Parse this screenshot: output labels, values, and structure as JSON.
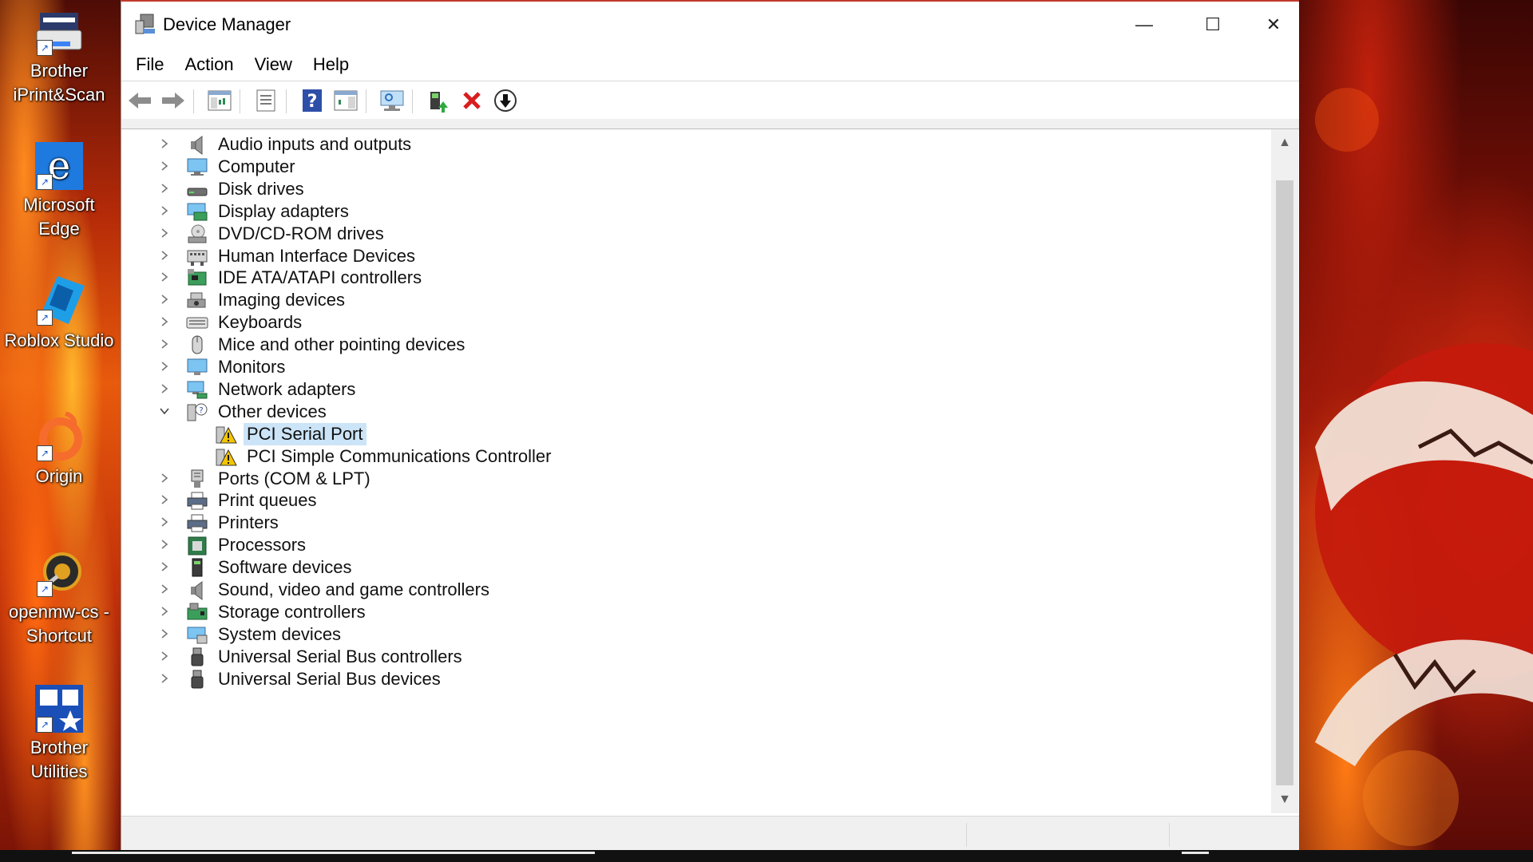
{
  "desktop": {
    "icons": [
      {
        "label_line1": "Brother",
        "label_line2": "iPrint&Scan",
        "icon": "brother-iprint-scan-icon"
      },
      {
        "label_line1": "Microsoft",
        "label_line2": "Edge",
        "icon": "microsoft-edge-icon"
      },
      {
        "label_line1": "Roblox Studio",
        "label_line2": "",
        "icon": "roblox-studio-icon"
      },
      {
        "label_line1": "Origin",
        "label_line2": "",
        "icon": "origin-icon"
      },
      {
        "label_line1": "openmw-cs -",
        "label_line2": "Shortcut",
        "icon": "openmw-cs-icon"
      },
      {
        "label_line1": "Brother",
        "label_line2": "Utilities",
        "icon": "brother-utilities-icon"
      }
    ]
  },
  "window": {
    "title": "Device Manager",
    "controls": {
      "minimize": "—",
      "maximize": "☐",
      "close": "✕"
    },
    "menu": [
      "File",
      "Action",
      "View",
      "Help"
    ],
    "toolbar": [
      "back",
      "forward",
      "show-hide-console-tree",
      "properties",
      "help",
      "show-action-pane",
      "scan-hardware",
      "update-driver",
      "uninstall-device",
      "enable-device"
    ]
  },
  "tree": {
    "items": [
      {
        "label": "Audio inputs and outputs",
        "icon": "speaker-icon",
        "expanded": false
      },
      {
        "label": "Computer",
        "icon": "computer-icon",
        "expanded": false
      },
      {
        "label": "Disk drives",
        "icon": "disk-drive-icon",
        "expanded": false
      },
      {
        "label": "Display adapters",
        "icon": "display-adapter-icon",
        "expanded": false
      },
      {
        "label": "DVD/CD-ROM drives",
        "icon": "dvd-drive-icon",
        "expanded": false
      },
      {
        "label": "Human Interface Devices",
        "icon": "hid-icon",
        "expanded": false
      },
      {
        "label": "IDE ATA/ATAPI controllers",
        "icon": "ide-controller-icon",
        "expanded": false
      },
      {
        "label": "Imaging devices",
        "icon": "imaging-device-icon",
        "expanded": false
      },
      {
        "label": "Keyboards",
        "icon": "keyboard-icon",
        "expanded": false
      },
      {
        "label": "Mice and other pointing devices",
        "icon": "mouse-icon",
        "expanded": false
      },
      {
        "label": "Monitors",
        "icon": "monitor-icon",
        "expanded": false
      },
      {
        "label": "Network adapters",
        "icon": "network-adapter-icon",
        "expanded": false
      },
      {
        "label": "Other devices",
        "icon": "unknown-device-icon",
        "expanded": true
      },
      {
        "label": "PCI Serial Port",
        "icon": "warning-device-icon",
        "child": true,
        "selected": true
      },
      {
        "label": "PCI Simple Communications Controller",
        "icon": "warning-device-icon",
        "child": true
      },
      {
        "label": "Ports (COM & LPT)",
        "icon": "port-icon",
        "expanded": false
      },
      {
        "label": "Print queues",
        "icon": "printer-icon",
        "expanded": false
      },
      {
        "label": "Printers",
        "icon": "printer-icon",
        "expanded": false
      },
      {
        "label": "Processors",
        "icon": "processor-icon",
        "expanded": false
      },
      {
        "label": "Software devices",
        "icon": "software-device-icon",
        "expanded": false
      },
      {
        "label": "Sound, video and game controllers",
        "icon": "speaker-icon",
        "expanded": false
      },
      {
        "label": "Storage controllers",
        "icon": "storage-controller-icon",
        "expanded": false
      },
      {
        "label": "System devices",
        "icon": "system-device-icon",
        "expanded": false
      },
      {
        "label": "Universal Serial Bus controllers",
        "icon": "usb-icon",
        "expanded": false
      },
      {
        "label": "Universal Serial Bus devices",
        "icon": "usb-icon",
        "expanded": false
      }
    ]
  },
  "colors": {
    "selection": "#cce4f7",
    "title_accent": "#c0392b",
    "warning": "#f5c400"
  }
}
